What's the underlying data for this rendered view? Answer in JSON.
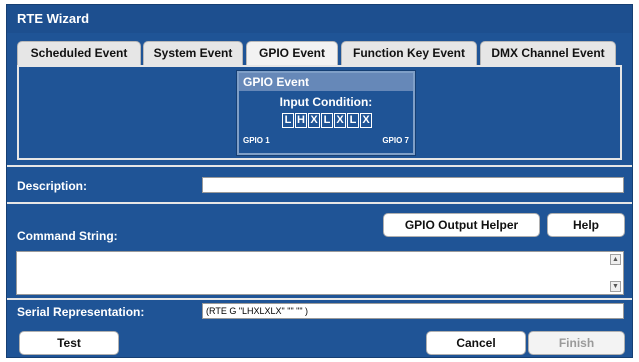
{
  "window": {
    "title": "RTE Wizard"
  },
  "tabs": [
    {
      "label": "Scheduled Event",
      "active": false
    },
    {
      "label": "System Event",
      "active": false
    },
    {
      "label": "GPIO Event",
      "active": true
    },
    {
      "label": "Function Key Event",
      "active": false
    },
    {
      "label": "DMX Channel Event",
      "active": false
    }
  ],
  "gpio": {
    "title": "GPIO Event",
    "condition_label": "Input Condition:",
    "cells": [
      "L",
      "H",
      "X",
      "L",
      "X",
      "L",
      "X"
    ],
    "first_label": "GPIO 1",
    "last_label": "GPIO 7"
  },
  "description": {
    "label": "Description:",
    "value": ""
  },
  "command": {
    "label": "Command String:",
    "output_helper_button": "GPIO Output Helper",
    "help_button": "Help",
    "value": ""
  },
  "serial": {
    "label": "Serial Representation:",
    "value": "(RTE G \"LHXLXLX\" \"\" \"\" )"
  },
  "footer": {
    "test_button": "Test",
    "cancel_button": "Cancel",
    "finish_button": "Finish"
  },
  "icons": {
    "scroll_up": "scroll-up-icon",
    "scroll_down": "scroll-down-icon"
  }
}
